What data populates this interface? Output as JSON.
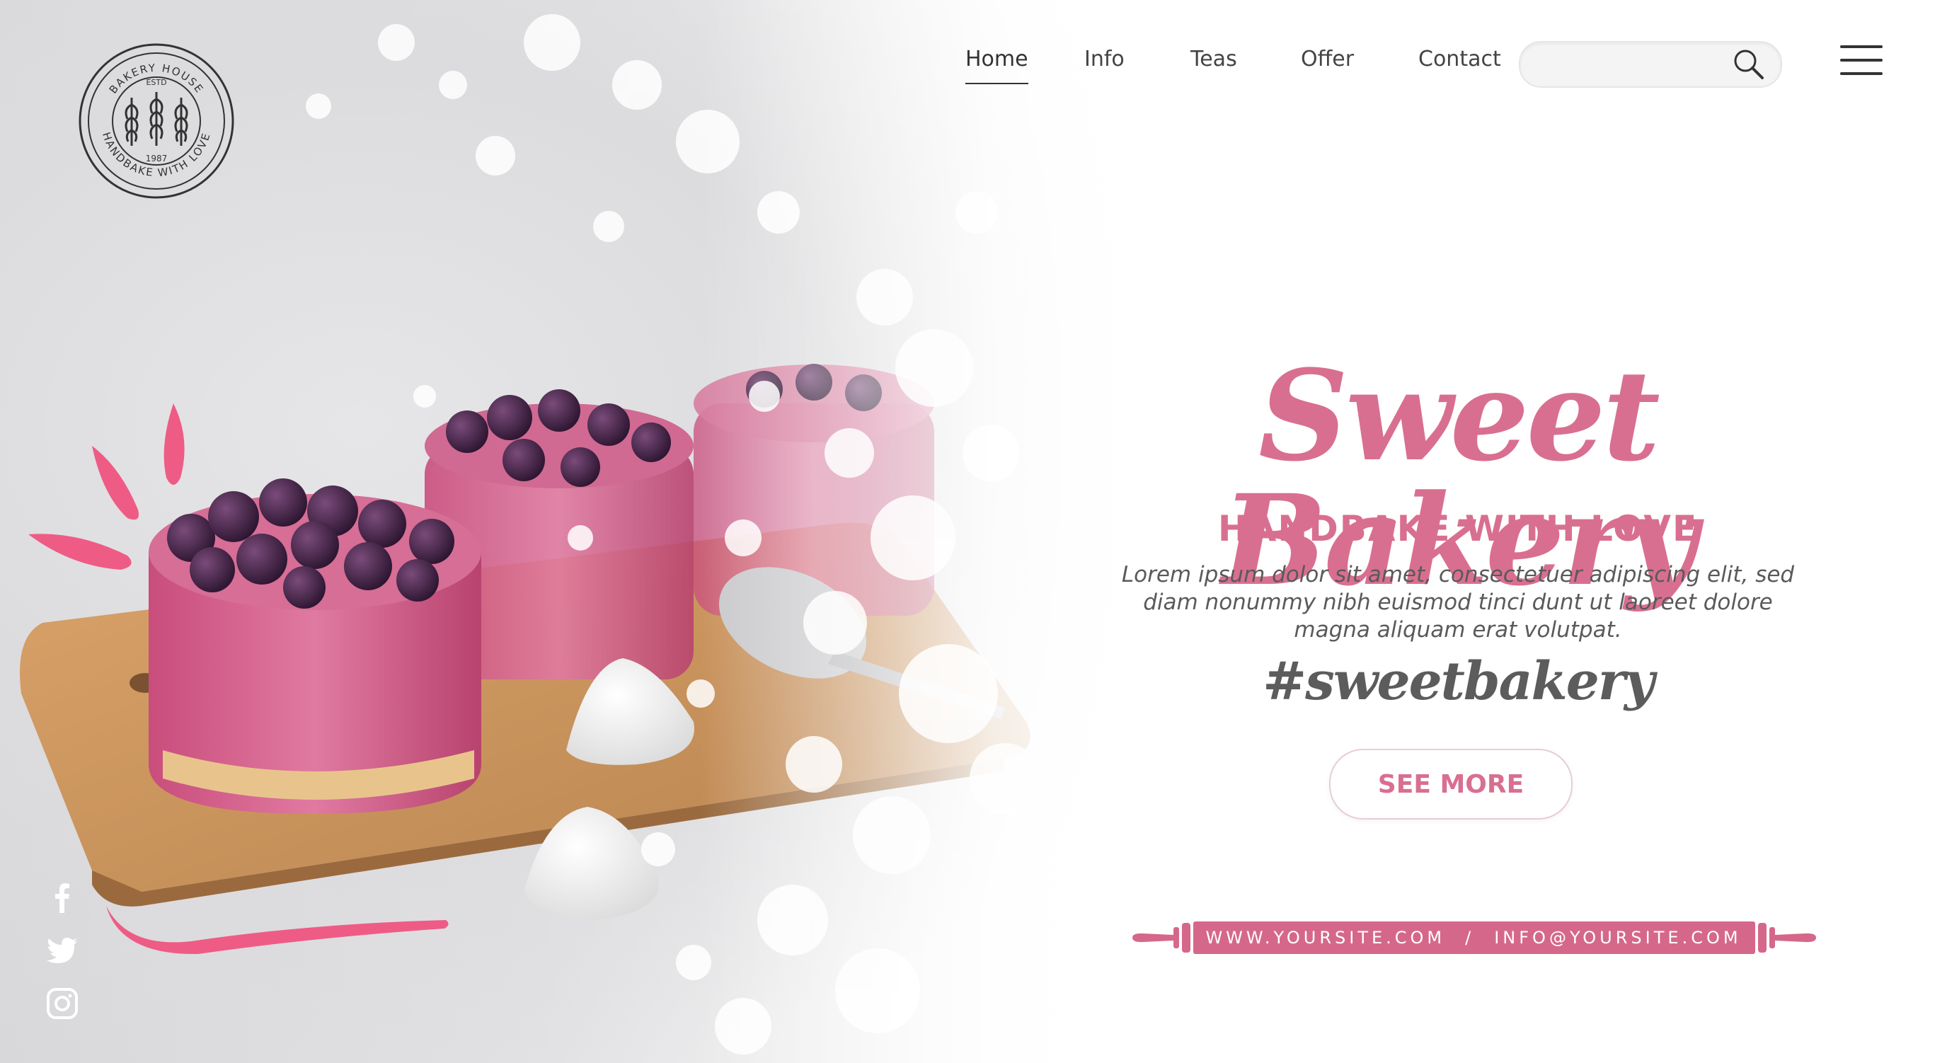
{
  "logo": {
    "top_text": "BAKERY HOUSE",
    "estd": "ESTD",
    "year": "1987",
    "bottom_text": "HANDBAKE WITH LOVE"
  },
  "nav": {
    "items": [
      {
        "label": "Home",
        "active": true
      },
      {
        "label": "Info",
        "active": false
      },
      {
        "label": "Teas",
        "active": false
      },
      {
        "label": "Offer",
        "active": false
      },
      {
        "label": "Contact",
        "active": false
      }
    ]
  },
  "search": {
    "value": "",
    "placeholder": "",
    "icon": "search-icon"
  },
  "menu": {
    "icon": "hamburger-menu-icon"
  },
  "hero": {
    "title": "Sweet Bakery",
    "subtitle": "HANDBAKE WITH LOVE",
    "body": "Lorem ipsum dolor sit amet, consectetuer adipiscing elit, sed diam nonummy nibh euismod tinci dunt ut laoreet dolore magna aliquam erat volutpat.",
    "hashtag": "#sweetbakery",
    "cta_label": "SEE MORE"
  },
  "footer": {
    "website": "WWW.YOURSITE.COM",
    "separator": "/",
    "email": "INFO@YOURSITE.COM"
  },
  "social": {
    "icons": [
      "facebook-icon",
      "twitter-icon",
      "instagram-icon"
    ]
  },
  "colors": {
    "accent_pink": "#d96f90",
    "bright_pink": "#ee5c86",
    "text_dark": "#444444",
    "pin_pink": "#d5688a"
  }
}
